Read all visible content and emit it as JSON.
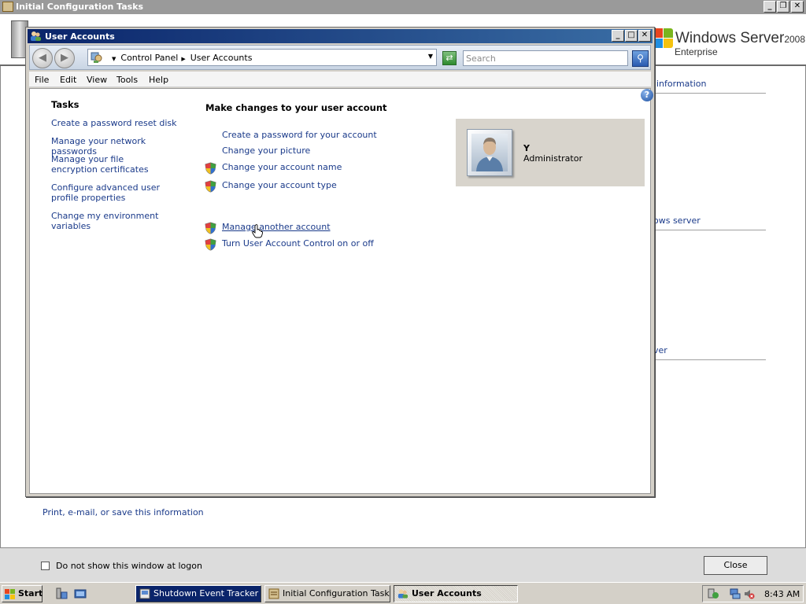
{
  "background_window": {
    "title": "Initial Configuration Tasks",
    "logo": {
      "name": "Windows Server",
      "version": "2008",
      "edition": "Enterprise"
    },
    "partial_links": [
      " information",
      "ows server",
      "ver"
    ],
    "print_link": "Print, e-mail, or save this information",
    "dont_show_label": "Do not show this window at logon",
    "close_label": "Close"
  },
  "user_accounts": {
    "title": "User Accounts",
    "breadcrumb": [
      "Control Panel",
      "User Accounts"
    ],
    "search_placeholder": "Search",
    "menu": [
      "File",
      "Edit",
      "View",
      "Tools",
      "Help"
    ],
    "tasks_heading": "Tasks",
    "tasks": [
      "Create a password reset disk",
      "Manage your network passwords",
      "Manage your file encryption certificates",
      "Configure advanced user profile properties",
      "Change my environment variables"
    ],
    "main_heading": "Make changes to your user account",
    "actions": [
      {
        "label": "Create a password for your account",
        "shield": false
      },
      {
        "label": "Change your picture",
        "shield": false
      },
      {
        "label": "Change your account name",
        "shield": true
      },
      {
        "label": "Change your account type",
        "shield": true
      },
      {
        "label": "Manage another account",
        "shield": true,
        "hovered": true
      },
      {
        "label": "Turn User Account Control on or off",
        "shield": true
      }
    ],
    "user": {
      "name": "Y",
      "role": "Administrator"
    }
  },
  "taskbar": {
    "start_label": "Start",
    "buttons": [
      {
        "label": "Shutdown Event Tracker",
        "icon": "shutdown-tracker-icon"
      },
      {
        "label": "Initial Configuration Tasks",
        "icon": "config-tasks-icon"
      },
      {
        "label": "User Accounts",
        "icon": "user-accounts-icon",
        "active": true
      }
    ],
    "clock": "8:43 AM"
  },
  "colors": {
    "link": "#1a3a8a",
    "active_titlebar": "#0a246a",
    "inactive_titlebar": "#9a9a9a",
    "taskbar_active": "#0a246a"
  }
}
